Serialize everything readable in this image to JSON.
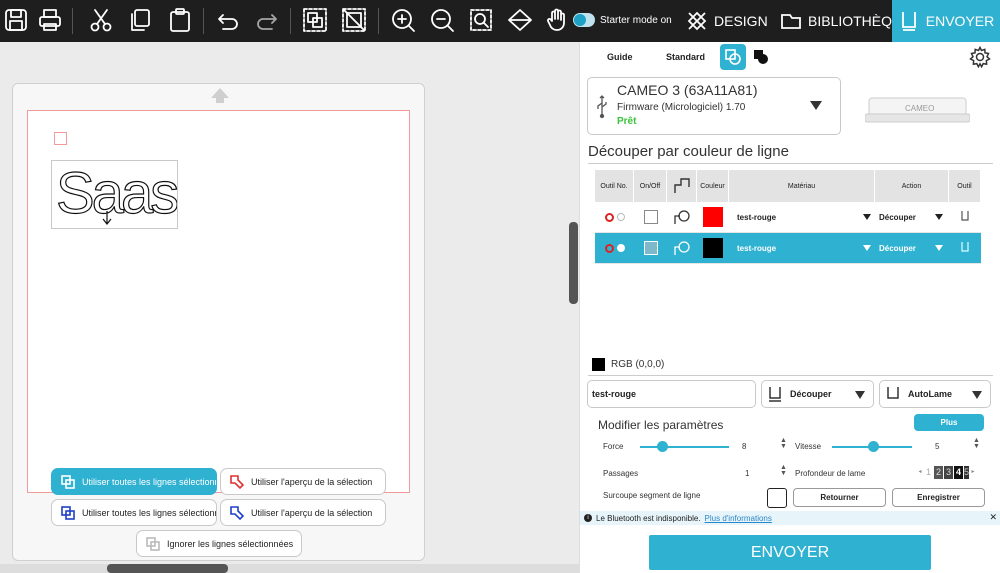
{
  "toolbar": {
    "icons": [
      "save-icon",
      "print-icon",
      "cut-icon",
      "copy-icon",
      "paste-icon",
      "undo-icon",
      "redo-icon",
      "group-icon",
      "ungroup-icon",
      "zoom-in-icon",
      "zoom-out-icon",
      "zoom-fit-icon",
      "flip-icon",
      "hand-icon"
    ],
    "starter_mode_label": "Starter mode on",
    "tabs": {
      "design": "DESIGN",
      "library": "BIBLIOTHÈQUE",
      "send": "ENVOYER"
    }
  },
  "canvas": {
    "design_text": "Saas",
    "buttons": [
      {
        "label": "Utiliser toutes les lignes sélectionnées"
      },
      {
        "label": "Utiliser l'aperçu de la sélection"
      },
      {
        "label": "Utiliser toutes les lignes sélectionnées"
      },
      {
        "label": "Utiliser l'aperçu de la sélection"
      },
      {
        "label": "Ignorer les lignes sélectionnées"
      }
    ]
  },
  "panel": {
    "modes": {
      "guide": "Guide",
      "standard": "Standard"
    },
    "device": {
      "name": "CAMEO 3 (63A11A81)",
      "firmware": "Firmware (Micrologiciel) 1.70",
      "status": "Prêt",
      "brand": "CAMEO"
    },
    "section_title": "Découper par couleur de ligne",
    "table": {
      "headers": [
        "Outil No.",
        "On/Off",
        "",
        "Couleur",
        "Matériau",
        "Action",
        "Outil"
      ],
      "rows": [
        {
          "material": "test-rouge",
          "action": "Découper",
          "color": "#ff0000",
          "selected": false
        },
        {
          "material": "test-rouge",
          "action": "Découper",
          "color": "#000000",
          "selected": true
        }
      ]
    },
    "rgb_label": "RGB (0,0,0)",
    "material_select": "test-rouge",
    "action_select": "Découper",
    "blade_select": "AutoLame",
    "modify_title": "Modifier les paramètres",
    "plus_label": "Plus",
    "force_label": "Force",
    "force_value": "8",
    "speed_label": "Vitesse",
    "speed_value": "5",
    "passes_label": "Passages",
    "passes_value": "1",
    "depth_label": "Profondeur de lame",
    "depth_digits": [
      "1",
      "2",
      "3",
      "4",
      "5"
    ],
    "overcut_label": "Surcoupe segment de ligne",
    "return_label": "Retourner",
    "save_label": "Enregistrer",
    "info_text": "Le Bluetooth est indisponible.",
    "info_link": "Plus d'informations",
    "send_label": "ENVOYER"
  },
  "colors": {
    "accent": "#2fb1d1",
    "toolbar_bg": "#1e1e1e",
    "ready": "#3ac23a"
  }
}
